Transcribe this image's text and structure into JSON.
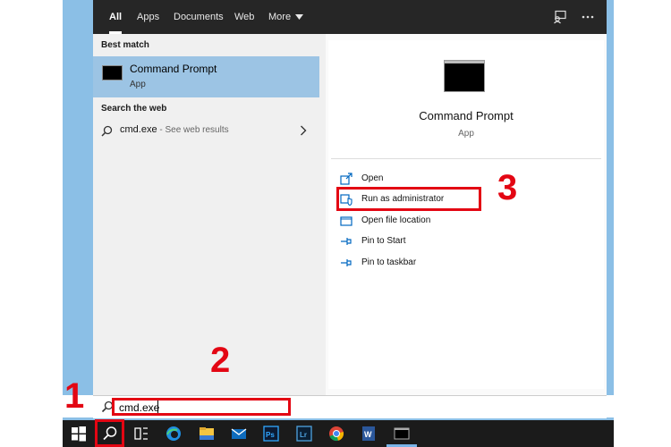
{
  "tabs": [
    "All",
    "Apps",
    "Documents",
    "Web",
    "More"
  ],
  "left_panel": {
    "best_match_label": "Best match",
    "best_match": {
      "title": "Command Prompt",
      "subtitle": "App"
    },
    "search_web_label": "Search the web",
    "web_result": {
      "query": "cmd.exe",
      "suffix": " - See web results"
    }
  },
  "right_panel": {
    "title": "Command Prompt",
    "subtitle": "App",
    "actions": [
      "Open",
      "Run as administrator",
      "Open file location",
      "Pin to Start",
      "Pin to taskbar"
    ]
  },
  "search": {
    "value": "cmd.exe"
  },
  "annotations": {
    "step1": "1",
    "step2": "2",
    "step3": "3"
  },
  "colors": {
    "annotation_red": "#e30613",
    "selection_blue": "#9cc4e4",
    "topbar_dark": "#262626",
    "taskbar_dark": "#1b1b1b"
  },
  "icons": {
    "taskbar": [
      "windows-logo",
      "search",
      "task-view",
      "edge",
      "file-explorer",
      "mail",
      "photoshop",
      "lightroom",
      "chrome",
      "word",
      "command-prompt"
    ],
    "topbar": [
      "feedback",
      "more-options"
    ],
    "actions": [
      "open",
      "run-as-admin",
      "open-file-location",
      "pin-to-start",
      "pin-to-taskbar"
    ]
  }
}
